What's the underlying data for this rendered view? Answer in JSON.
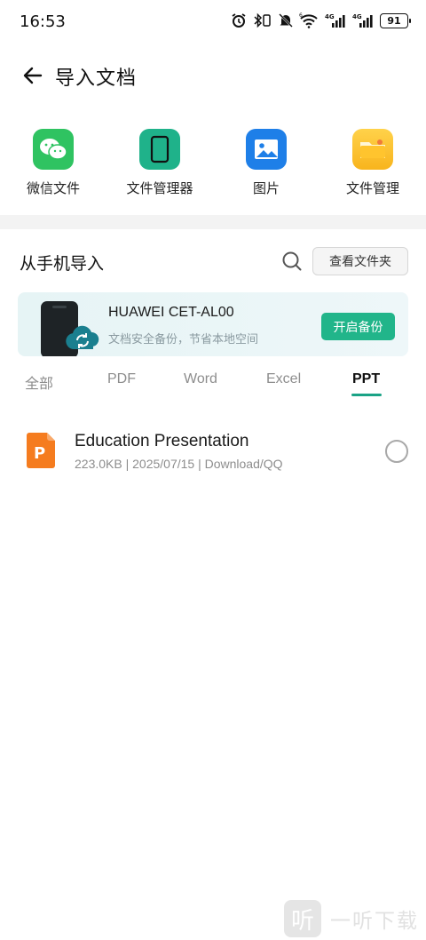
{
  "status_bar": {
    "time": "16:53",
    "battery": "91",
    "network_1": "4G",
    "network_2": "4G",
    "wifi_label": "6",
    "icons": [
      "alarm-icon",
      "bluetooth-icon",
      "vibrate-icon",
      "mute-icon",
      "wifi-icon",
      "signal-icon",
      "signal-icon",
      "battery-icon"
    ]
  },
  "header": {
    "title": "导入文档",
    "back_icon": "back-arrow-icon"
  },
  "shortcuts": [
    {
      "label": "微信文件",
      "icon": "wechat-icon",
      "color": "#2fc361"
    },
    {
      "label": "文件管理器",
      "icon": "phone-icon",
      "color": "#1fb28a"
    },
    {
      "label": "图片",
      "icon": "image-icon",
      "color": "#1e7fe8"
    },
    {
      "label": "文件管理",
      "icon": "folder-icon",
      "color": "#f8b41d"
    }
  ],
  "import_section": {
    "title": "从手机导入",
    "view_folder_label": "查看文件夹"
  },
  "backup_banner": {
    "device_name": "HUAWEI CET-AL00",
    "subtitle": "文档安全备份，节省本地空间",
    "button_label": "开启备份",
    "accent": "#21b58a"
  },
  "tabs": [
    {
      "label": "全部",
      "active": false
    },
    {
      "label": "PDF",
      "active": false
    },
    {
      "label": "Word",
      "active": false
    },
    {
      "label": "Excel",
      "active": false
    },
    {
      "label": "PPT",
      "active": true
    }
  ],
  "files": [
    {
      "name": "Education Presentation",
      "meta": "223.0KB | 2025/07/15 | Download/QQ",
      "type_letter": "P",
      "icon": "ppt-file-icon",
      "color": "#f57c1f"
    }
  ],
  "watermark": {
    "glyph": "听",
    "text": "一听下载"
  }
}
